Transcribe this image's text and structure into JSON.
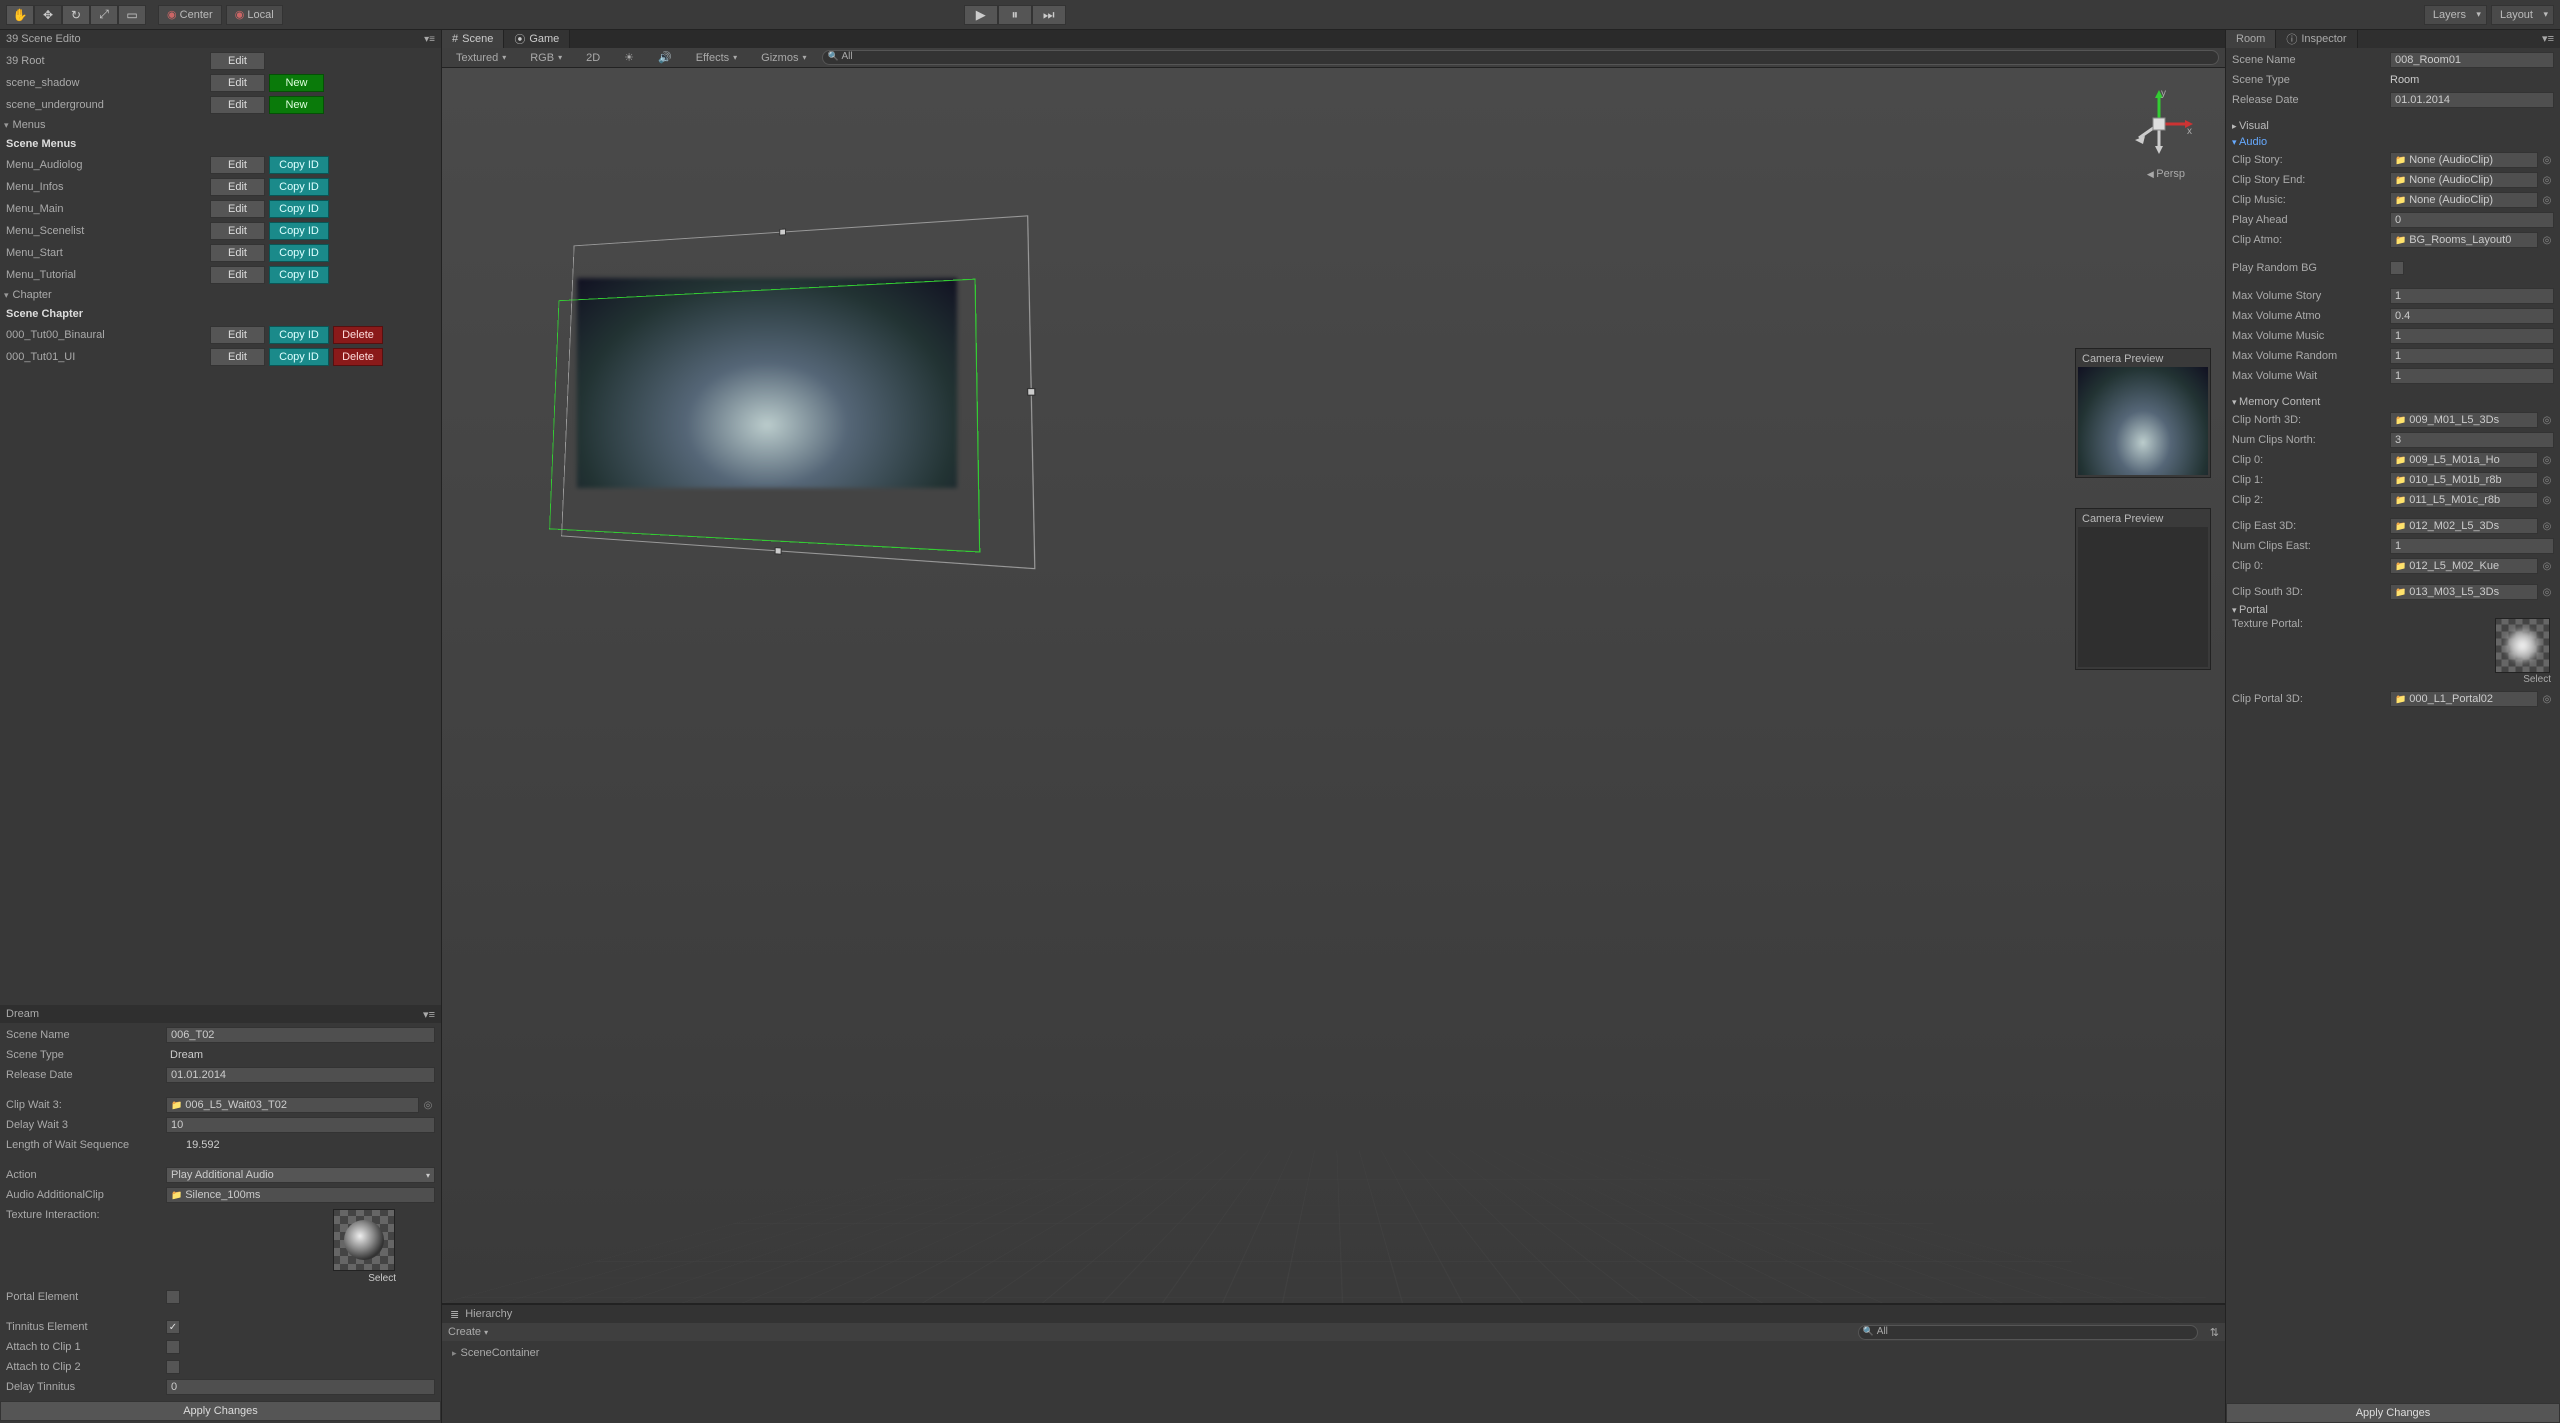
{
  "toolbar": {
    "pivot_center": "Center",
    "coord_local": "Local",
    "layers": "Layers",
    "layout": "Layout"
  },
  "leftPanel": {
    "title": "39 Scene Edito",
    "root": "39 Root",
    "scene_shadow": "scene_shadow",
    "scene_underground": "scene_underground",
    "menus_fold": "Menus",
    "scene_menus_header": "Scene Menus",
    "menus": [
      "Menu_Audiolog",
      "Menu_Infos",
      "Menu_Main",
      "Menu_Scenelist",
      "Menu_Start",
      "Menu_Tutorial"
    ],
    "chapter_fold": "Chapter",
    "scene_chapter_header": "Scene Chapter",
    "chapters": [
      "000_Tut00_Binaural",
      "000_Tut01_UI"
    ],
    "btn_edit": "Edit",
    "btn_new": "New",
    "btn_copyid": "Copy ID",
    "btn_delete": "Delete"
  },
  "dream": {
    "title": "Dream",
    "scene_name_label": "Scene Name",
    "scene_name": "006_T02",
    "scene_type_label": "Scene Type",
    "scene_type": "Dream",
    "release_date_label": "Release Date",
    "release_date": "01.01.2014",
    "clip_wait3_label": "Clip Wait 3:",
    "clip_wait3": "006_L5_Wait03_T02",
    "delay_wait3_label": "Delay Wait 3",
    "delay_wait3": "10",
    "length_wait_label": "Length of Wait Sequence",
    "length_wait": "19.592",
    "action_label": "Action",
    "action": "Play Additional Audio",
    "audio_addclip_label": "Audio AdditionalClip",
    "audio_addclip": "Silence_100ms",
    "texture_interaction_label": "Texture Interaction:",
    "select_label": "Select",
    "portal_element_label": "Portal Element",
    "tinnitus_element_label": "Tinnitus Element",
    "attach_clip1_label": "Attach to Clip 1",
    "attach_clip2_label": "Attach to Clip 2",
    "delay_tinnitus_label": "Delay Tinnitus",
    "delay_tinnitus": "0",
    "apply": "Apply Changes"
  },
  "scene": {
    "tab_scene": "Scene",
    "tab_game": "Game",
    "shading": "Textured",
    "render": "RGB",
    "mode_2d": "2D",
    "effects": "Effects",
    "gizmos": "Gizmos",
    "search_ph": "All",
    "persp": "Persp",
    "campreview": "Camera Preview"
  },
  "hierarchy": {
    "title": "Hierarchy",
    "create": "Create",
    "search_ph": "All",
    "item0": "SceneContainer"
  },
  "room": {
    "tab_room": "Room",
    "tab_inspector": "Inspector",
    "scene_name_label": "Scene Name",
    "scene_name": "008_Room01",
    "scene_type_label": "Scene Type",
    "scene_type": "Room",
    "release_date_label": "Release Date",
    "release_date": "01.01.2014",
    "visual_fold": "Visual",
    "audio_fold": "Audio",
    "clip_story_label": "Clip Story:",
    "clip_story": "None (AudioClip)",
    "clip_story_end_label": "Clip Story End:",
    "clip_story_end": "None (AudioClip)",
    "clip_music_label": "Clip Music:",
    "clip_music": "None (AudioClip)",
    "play_ahead_label": "Play Ahead",
    "play_ahead": "0",
    "clip_atmo_label": "Clip Atmo:",
    "clip_atmo": "BG_Rooms_Layout0",
    "play_random_bg_label": "Play Random BG",
    "max_vol_story_label": "Max Volume Story",
    "max_vol_story": "1",
    "max_vol_atmo_label": "Max Volume Atmo",
    "max_vol_atmo": "0.4",
    "max_vol_music_label": "Max Volume Music",
    "max_vol_music": "1",
    "max_vol_random_label": "Max Volume Random",
    "max_vol_random": "1",
    "max_vol_wait_label": "Max Volume Wait",
    "max_vol_wait": "1",
    "memory_content_fold": "Memory Content",
    "clip_north_3d_label": "Clip North 3D:",
    "clip_north_3d": "009_M01_L5_3Ds",
    "num_clips_north_label": "Num Clips North:",
    "num_clips_north": "3",
    "clip0_label": "Clip 0:",
    "clip0": "009_L5_M01a_Ho",
    "clip1_label": "Clip 1:",
    "clip1": "010_L5_M01b_r8b",
    "clip2_label": "Clip 2:",
    "clip2": "011_L5_M01c_r8b",
    "clip_east_3d_label": "Clip East 3D:",
    "clip_east_3d": "012_M02_L5_3Ds",
    "num_clips_east_label": "Num Clips East:",
    "num_clips_east": "1",
    "east_clip0": "012_L5_M02_Kue",
    "clip_south_3d_label": "Clip South 3D:",
    "clip_south_3d": "013_M03_L5_3Ds",
    "portal_fold": "Portal",
    "texture_portal_label": "Texture Portal:",
    "clip_portal_3d_label": "Clip Portal 3D:",
    "clip_portal_3d": "000_L1_Portal02",
    "select_label": "Select",
    "apply": "Apply Changes"
  }
}
